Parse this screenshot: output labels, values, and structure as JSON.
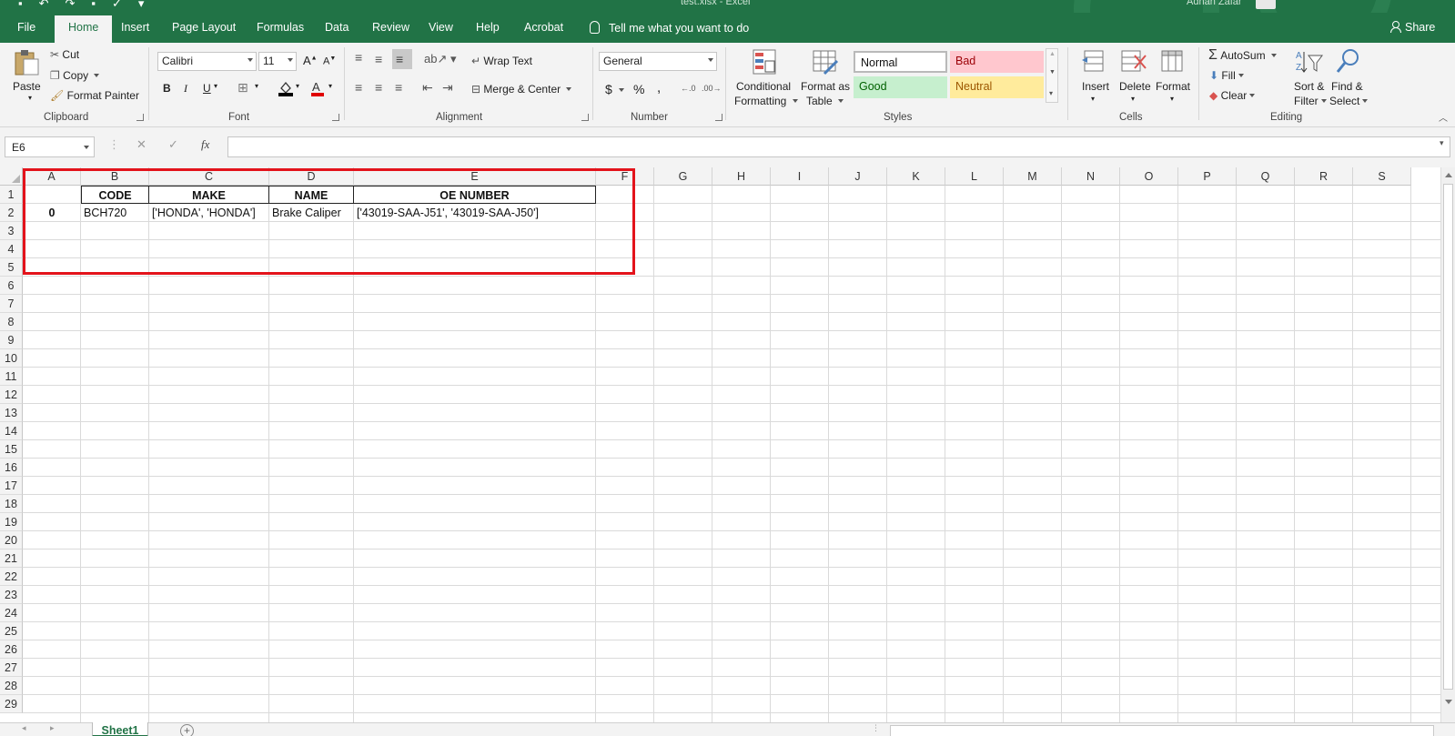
{
  "titlebar": {
    "file_name": "test.xlsx",
    "app_name": "Excel",
    "user": "Adnan Zafar"
  },
  "tabs": [
    {
      "label": "File"
    },
    {
      "label": "Home"
    },
    {
      "label": "Insert"
    },
    {
      "label": "Page Layout"
    },
    {
      "label": "Formulas"
    },
    {
      "label": "Data"
    },
    {
      "label": "Review"
    },
    {
      "label": "View"
    },
    {
      "label": "Help"
    },
    {
      "label": "Acrobat"
    }
  ],
  "tell_me": "Tell me what you want to do",
  "share": "Share",
  "ribbon": {
    "clipboard": {
      "label": "Clipboard",
      "paste": "Paste",
      "cut": "Cut",
      "copy": "Copy",
      "format_painter": "Format Painter"
    },
    "font": {
      "label": "Font",
      "font_name": "Calibri",
      "font_size": "11",
      "bold": "B",
      "italic": "I",
      "underline": "U"
    },
    "alignment": {
      "label": "Alignment",
      "wrap_text": "Wrap Text",
      "merge_center": "Merge & Center"
    },
    "number": {
      "label": "Number",
      "format": "General",
      "currency": "$",
      "percent": "%",
      "comma": ","
    },
    "styles": {
      "label": "Styles",
      "conditional_formatting": [
        "Conditional",
        "Formatting"
      ],
      "format_as_table": [
        "Format as",
        "Table"
      ],
      "normal": "Normal",
      "bad": "Bad",
      "good": "Good",
      "neutral": "Neutral"
    },
    "cells": {
      "label": "Cells",
      "insert": "Insert",
      "delete": "Delete",
      "format": "Format"
    },
    "editing": {
      "label": "Editing",
      "autosum": "AutoSum",
      "fill": "Fill",
      "clear": "Clear",
      "sort_filter": [
        "Sort &",
        "Filter"
      ],
      "find_select": [
        "Find &",
        "Select"
      ]
    }
  },
  "formula_bar": {
    "name_box": "E6",
    "fx": "fx",
    "formula": ""
  },
  "columns": [
    "A",
    "B",
    "C",
    "D",
    "E",
    "F",
    "G",
    "H",
    "I",
    "J",
    "K",
    "L",
    "M",
    "N",
    "O",
    "P",
    "Q",
    "R",
    "S"
  ],
  "rows": [
    "1",
    "2",
    "3",
    "4",
    "5",
    "6",
    "7",
    "8",
    "9",
    "10",
    "11",
    "12",
    "13",
    "14",
    "15",
    "16",
    "17",
    "18",
    "19",
    "20",
    "21",
    "22",
    "23",
    "24",
    "25",
    "26",
    "27",
    "28",
    "29"
  ],
  "table": {
    "headers": {
      "B": "CODE",
      "C": "MAKE",
      "D": "NAME",
      "E": "OE NUMBER"
    },
    "row2": {
      "A": "0",
      "B": "BCH720",
      "C": "['HONDA', 'HONDA']",
      "D": "Brake Caliper",
      "E": "['43019-SAA-J51', '43019-SAA-J50']"
    }
  },
  "sheets": [
    {
      "label": "Sheet1"
    }
  ],
  "colors": {
    "excel_green": "#217346",
    "highlight_border": "#e3131b",
    "bad_fill": "#ffc7ce",
    "good_fill": "#c6efce",
    "neutral_fill": "#ffeb9c"
  }
}
